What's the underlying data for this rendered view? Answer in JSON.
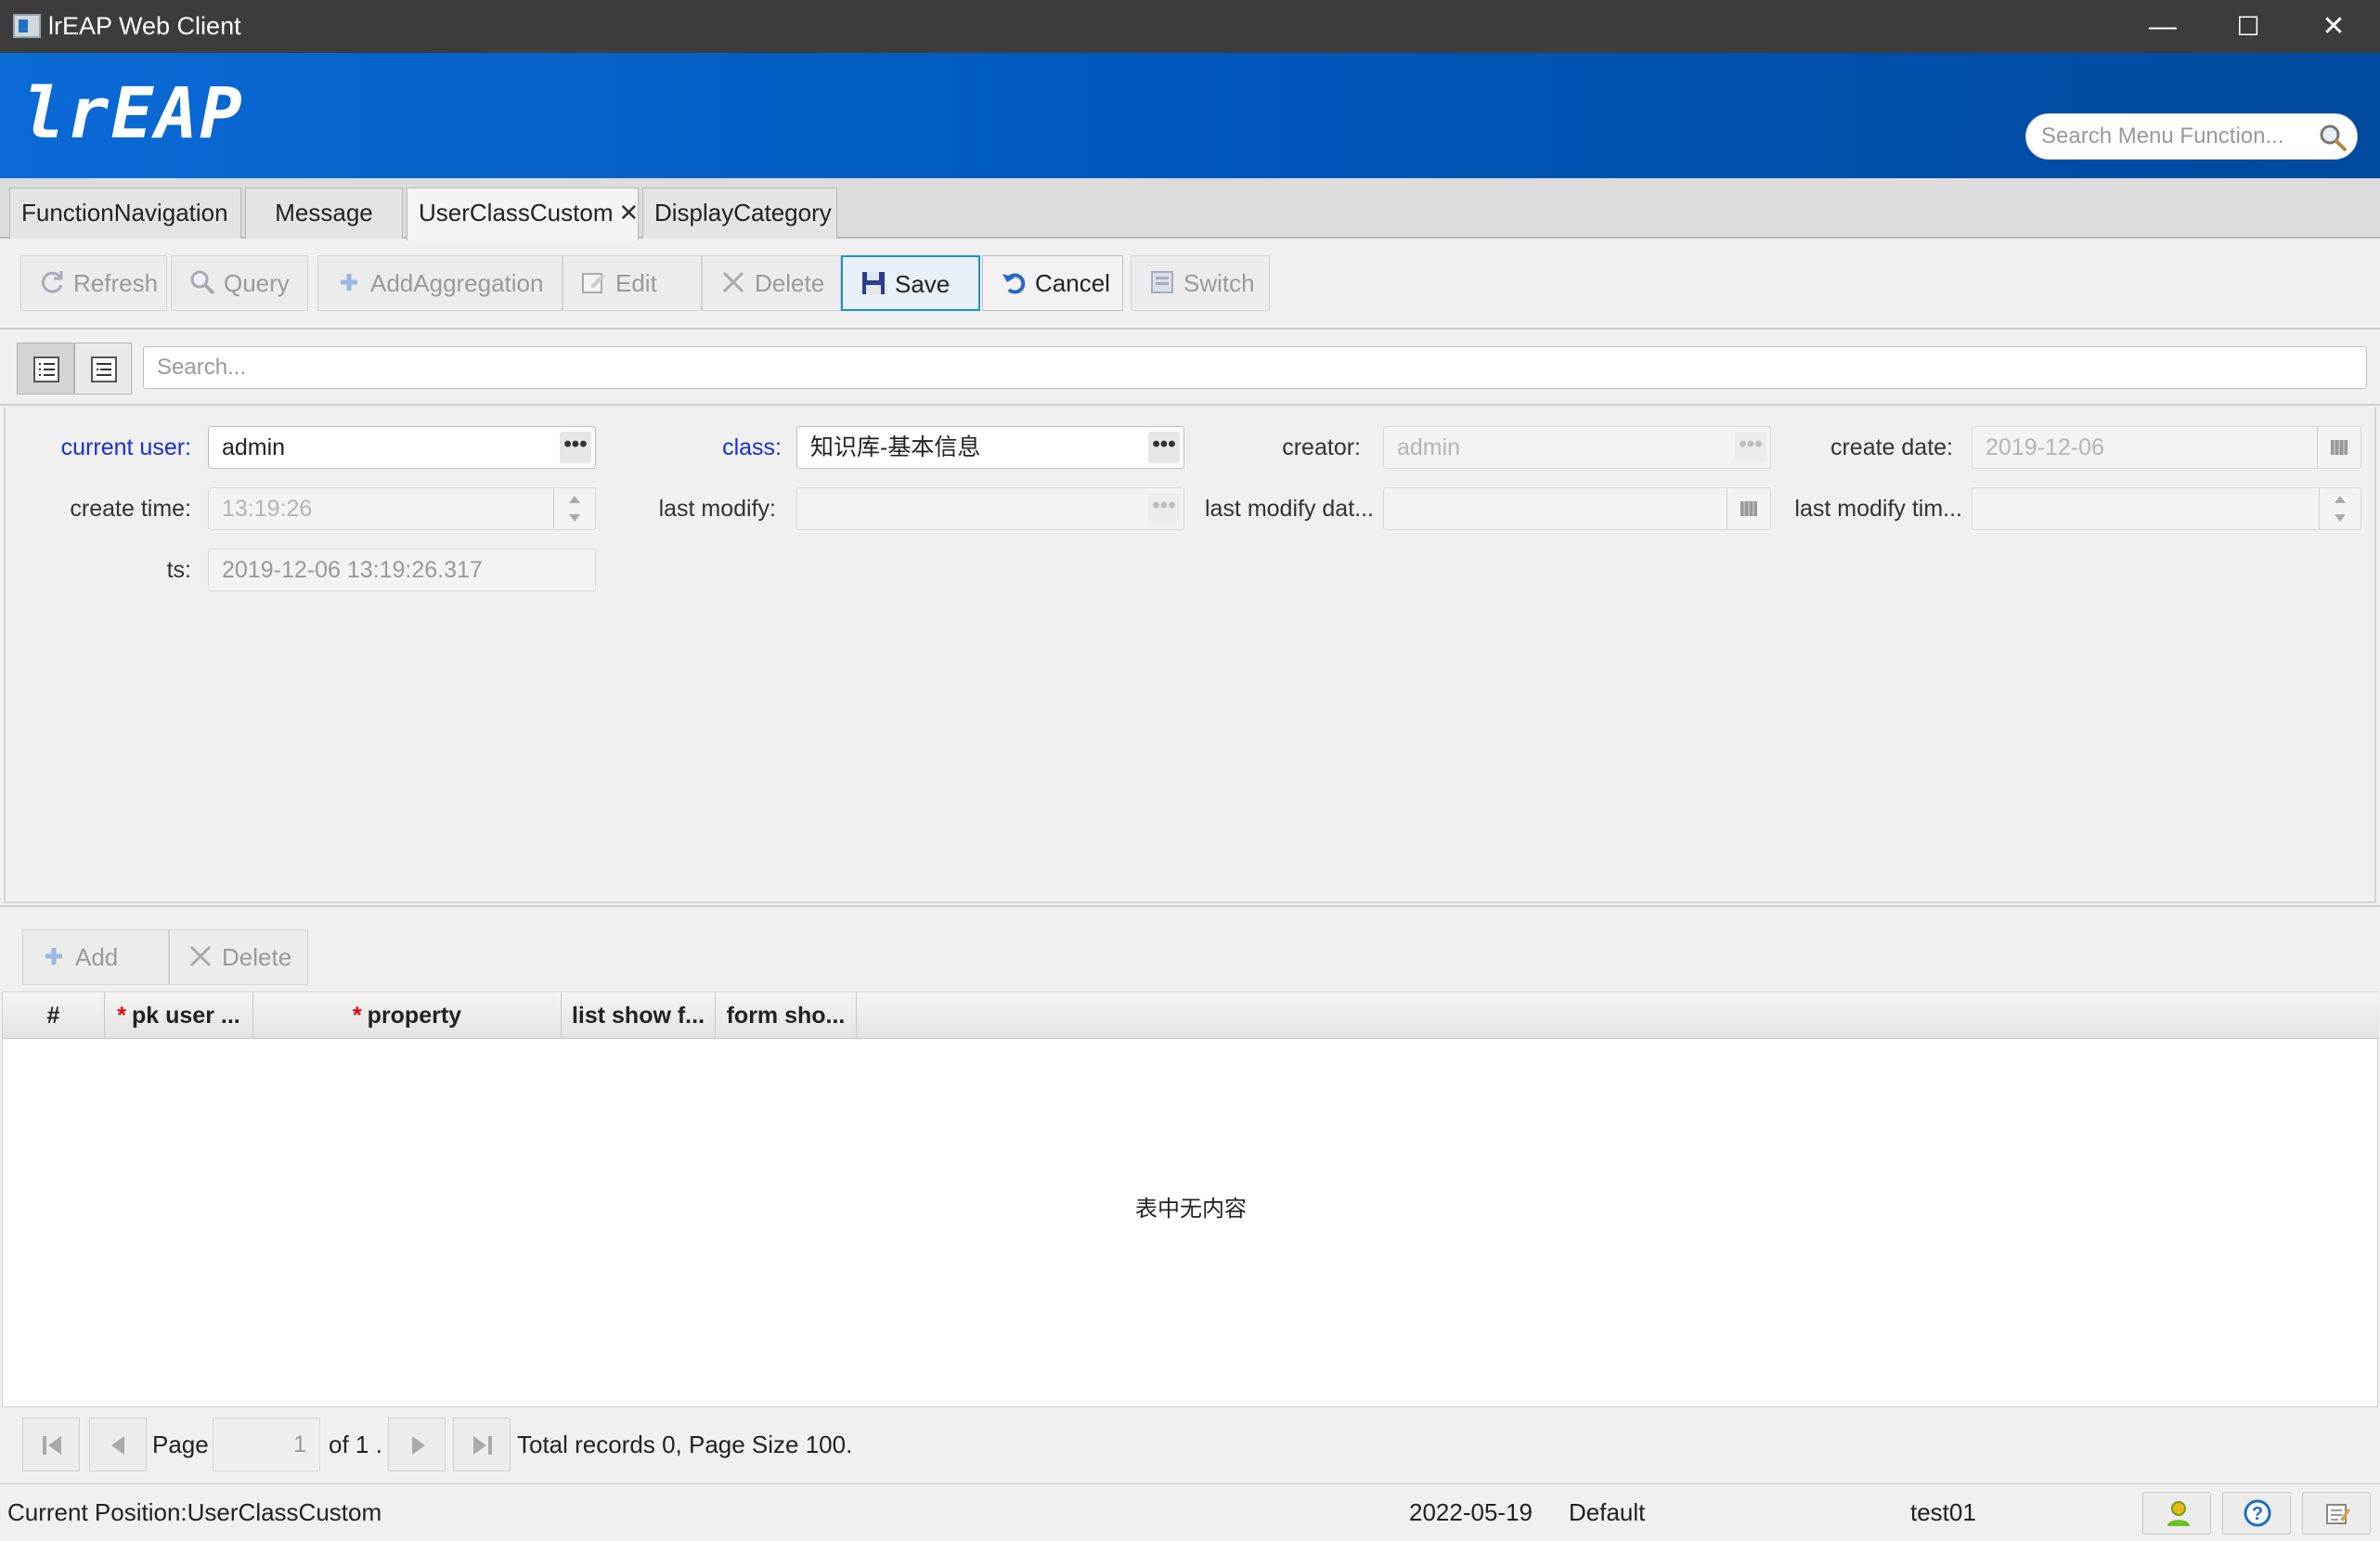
{
  "window": {
    "title": "lrEAP Web Client",
    "min": "—",
    "max": "☐",
    "close": "✕"
  },
  "banner": {
    "logo": "lrEAP",
    "search_placeholder": "Search Menu Function..."
  },
  "tabs": [
    {
      "label": "FunctionNavigation"
    },
    {
      "label": "Message"
    },
    {
      "label": "UserClassCustom",
      "close": "✕",
      "active": true
    },
    {
      "label": "DisplayCategory"
    }
  ],
  "toolbar": {
    "refresh": "Refresh",
    "query": "Query",
    "add_aggregation": "AddAggregation",
    "edit": "Edit",
    "delete": "Delete",
    "save": "Save",
    "cancel": "Cancel",
    "switch": "Switch"
  },
  "search": {
    "placeholder": "Search..."
  },
  "form": {
    "current_user": {
      "label": "current user:",
      "value": "admin"
    },
    "class": {
      "label": "class:",
      "value": "知识库-基本信息"
    },
    "creator": {
      "label": "creator:",
      "value": "admin"
    },
    "create_date": {
      "label": "create date:",
      "value": "2019-12-06"
    },
    "create_time": {
      "label": "create time:",
      "value": "13:19:26"
    },
    "last_modify": {
      "label": "last modify:",
      "value": ""
    },
    "last_modify_date": {
      "label": "last modify dat...",
      "value": ""
    },
    "last_modify_time": {
      "label": "last modify tim...",
      "value": ""
    },
    "ts": {
      "label": "ts:",
      "value": "2019-12-06 13:19:26.317"
    },
    "ellipsis": "•••"
  },
  "detail": {
    "add": "Add",
    "delete": "Delete",
    "columns": {
      "num": "#",
      "pk_user": "pk user ...",
      "property": "property",
      "list_show": "list show f...",
      "form_show": "form sho...",
      "required_mark": "*"
    },
    "empty_text": "表中无内容"
  },
  "pager": {
    "page_label": "Page",
    "page_value": "1",
    "of_text": "of 1 .",
    "summary": "Total records  0, Page Size 100."
  },
  "status": {
    "position": "Current Position:UserClassCustom",
    "date": "2022-05-19",
    "theme": "Default",
    "user": "test01"
  },
  "colors": {
    "banner": "#0056b8",
    "required_label": "#1a2ed0",
    "focus": "#1f8dd6",
    "required_star": "#e00000"
  }
}
